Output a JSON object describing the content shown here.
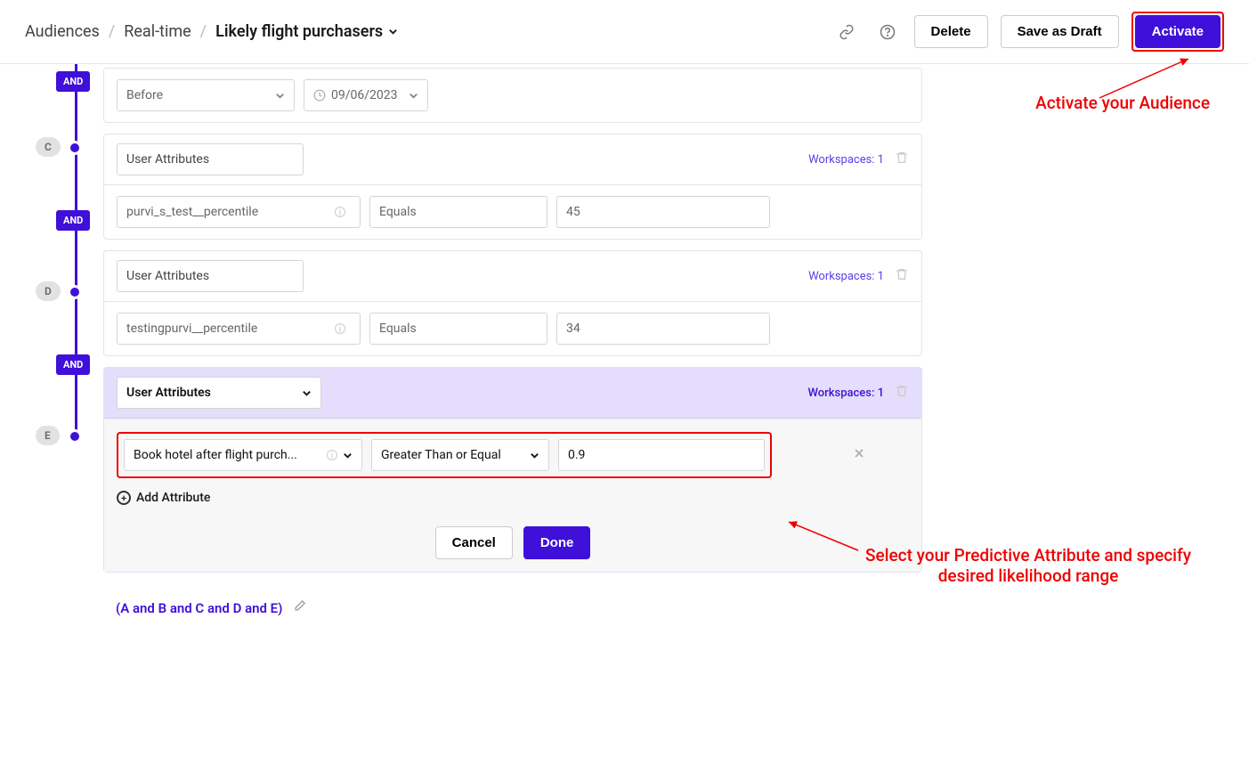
{
  "breadcrumb": {
    "root": "Audiences",
    "mid": "Real-time",
    "final": "Likely flight purchasers"
  },
  "header": {
    "delete": "Delete",
    "draft": "Save as Draft",
    "activate": "Activate"
  },
  "tree": {
    "and": "AND",
    "c": "C",
    "d": "D",
    "e": "E"
  },
  "blockTop": {
    "op": "Before",
    "date": "09/06/2023"
  },
  "blockC": {
    "kind": "User Attributes",
    "ws": "Workspaces: 1",
    "attr": "purvi_s_test__percentile",
    "op": "Equals",
    "val": "45"
  },
  "blockD": {
    "kind": "User Attributes",
    "ws": "Workspaces: 1",
    "attr": "testingpurvi__percentile",
    "op": "Equals",
    "val": "34"
  },
  "blockE": {
    "kind": "User Attributes",
    "ws": "Workspaces: 1",
    "attr": "Book hotel after flight purch...",
    "op": "Greater Than or Equal",
    "val": "0.9",
    "add": "Add Attribute",
    "cancel": "Cancel",
    "done": "Done"
  },
  "expr": "(A and B and C and D and E)",
  "anno": {
    "activate": "Activate your Audience",
    "attr": "Select your Predictive Attribute and specify desired likelihood range"
  }
}
